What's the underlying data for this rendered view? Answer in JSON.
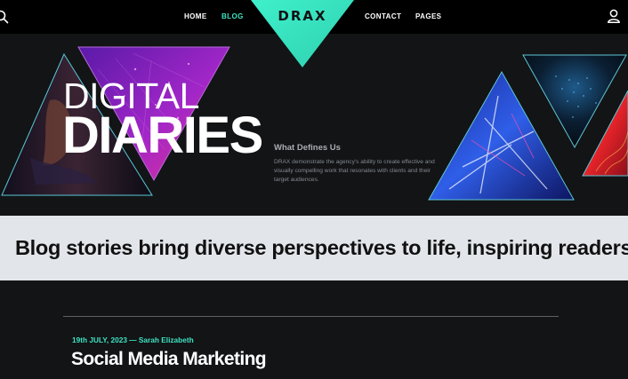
{
  "brand": {
    "logo": "DRAX",
    "accent": "#3fe3c2"
  },
  "nav": {
    "search_icon": "search-icon",
    "user_icon": "user-icon",
    "links": [
      {
        "label": "HOME",
        "active": false
      },
      {
        "label": "BLOG",
        "active": true
      },
      {
        "label": "CONTACT",
        "active": false
      },
      {
        "label": "PAGES",
        "active": false
      }
    ]
  },
  "hero": {
    "title_line1": "DIGITAL",
    "title_line2": "DIARIES",
    "defines": {
      "title": "What Defines Us",
      "body": "DRAX demonstrate the agency's ability to create effective and visually compelling work that resonates with clients and their target audiences."
    }
  },
  "banner": {
    "text": "Blog stories bring diverse perspectives to life, inspiring readers"
  },
  "post": {
    "meta": "19th JULY, 2023 — Sarah Elizabeth",
    "title": "Social Media Marketing"
  }
}
